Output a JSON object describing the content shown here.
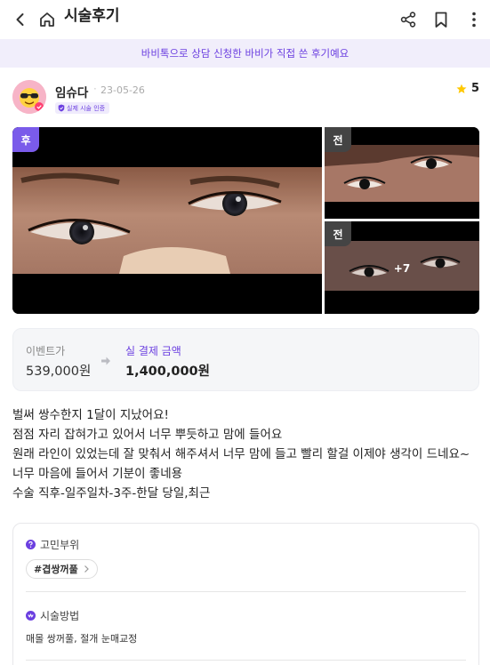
{
  "header": {
    "title": "시술후기"
  },
  "banner": {
    "text": "바비톡으로 상담 신청한 바비가 직접 쓴 후기예요"
  },
  "review": {
    "author": "임슈다",
    "separator": "·",
    "date": "23-05-26",
    "verified_badge": "실제 시술 인증",
    "rating": "5"
  },
  "photos": {
    "after_tag": "후",
    "before_tag": "전",
    "more_count": "+7"
  },
  "price": {
    "event_label": "이벤트가",
    "event_value": "539,000원",
    "paid_label": "실 결제 금액",
    "paid_value": "1,400,000원"
  },
  "body": {
    "lines": [
      "벌써 쌍수한지 1달이 지났어요!",
      "점점 자리 잡혀가고 있어서 너무 뿌듯하고 맘에 들어요",
      "원래 라인이 있었는데 잘 맞춰서 해주셔서 너무 맘에 들고 빨리 할걸 이제야 생각이 드네요~",
      "너무 마음에 들어서 기분이 좋네용",
      "수술 직후-일주일차-3주-한달 당일,최근"
    ]
  },
  "info": {
    "concern_title": "고민부위",
    "concern_chip": "#겹쌍꺼풀",
    "method_title": "시술방법",
    "method_text": "매몰 쌍꺼풀, 절개 눈매교정"
  },
  "colors": {
    "accent": "#6b3fe0",
    "banner_bg": "#f1eefb",
    "star": "#ffc800"
  },
  "icons": [
    "back-arrow-icon",
    "home-icon",
    "share-icon",
    "bookmark-icon",
    "more-vertical-icon",
    "star-icon",
    "shield-check-icon",
    "arrow-right-icon",
    "question-circle-icon",
    "method-badge-icon",
    "chevron-right-icon"
  ]
}
